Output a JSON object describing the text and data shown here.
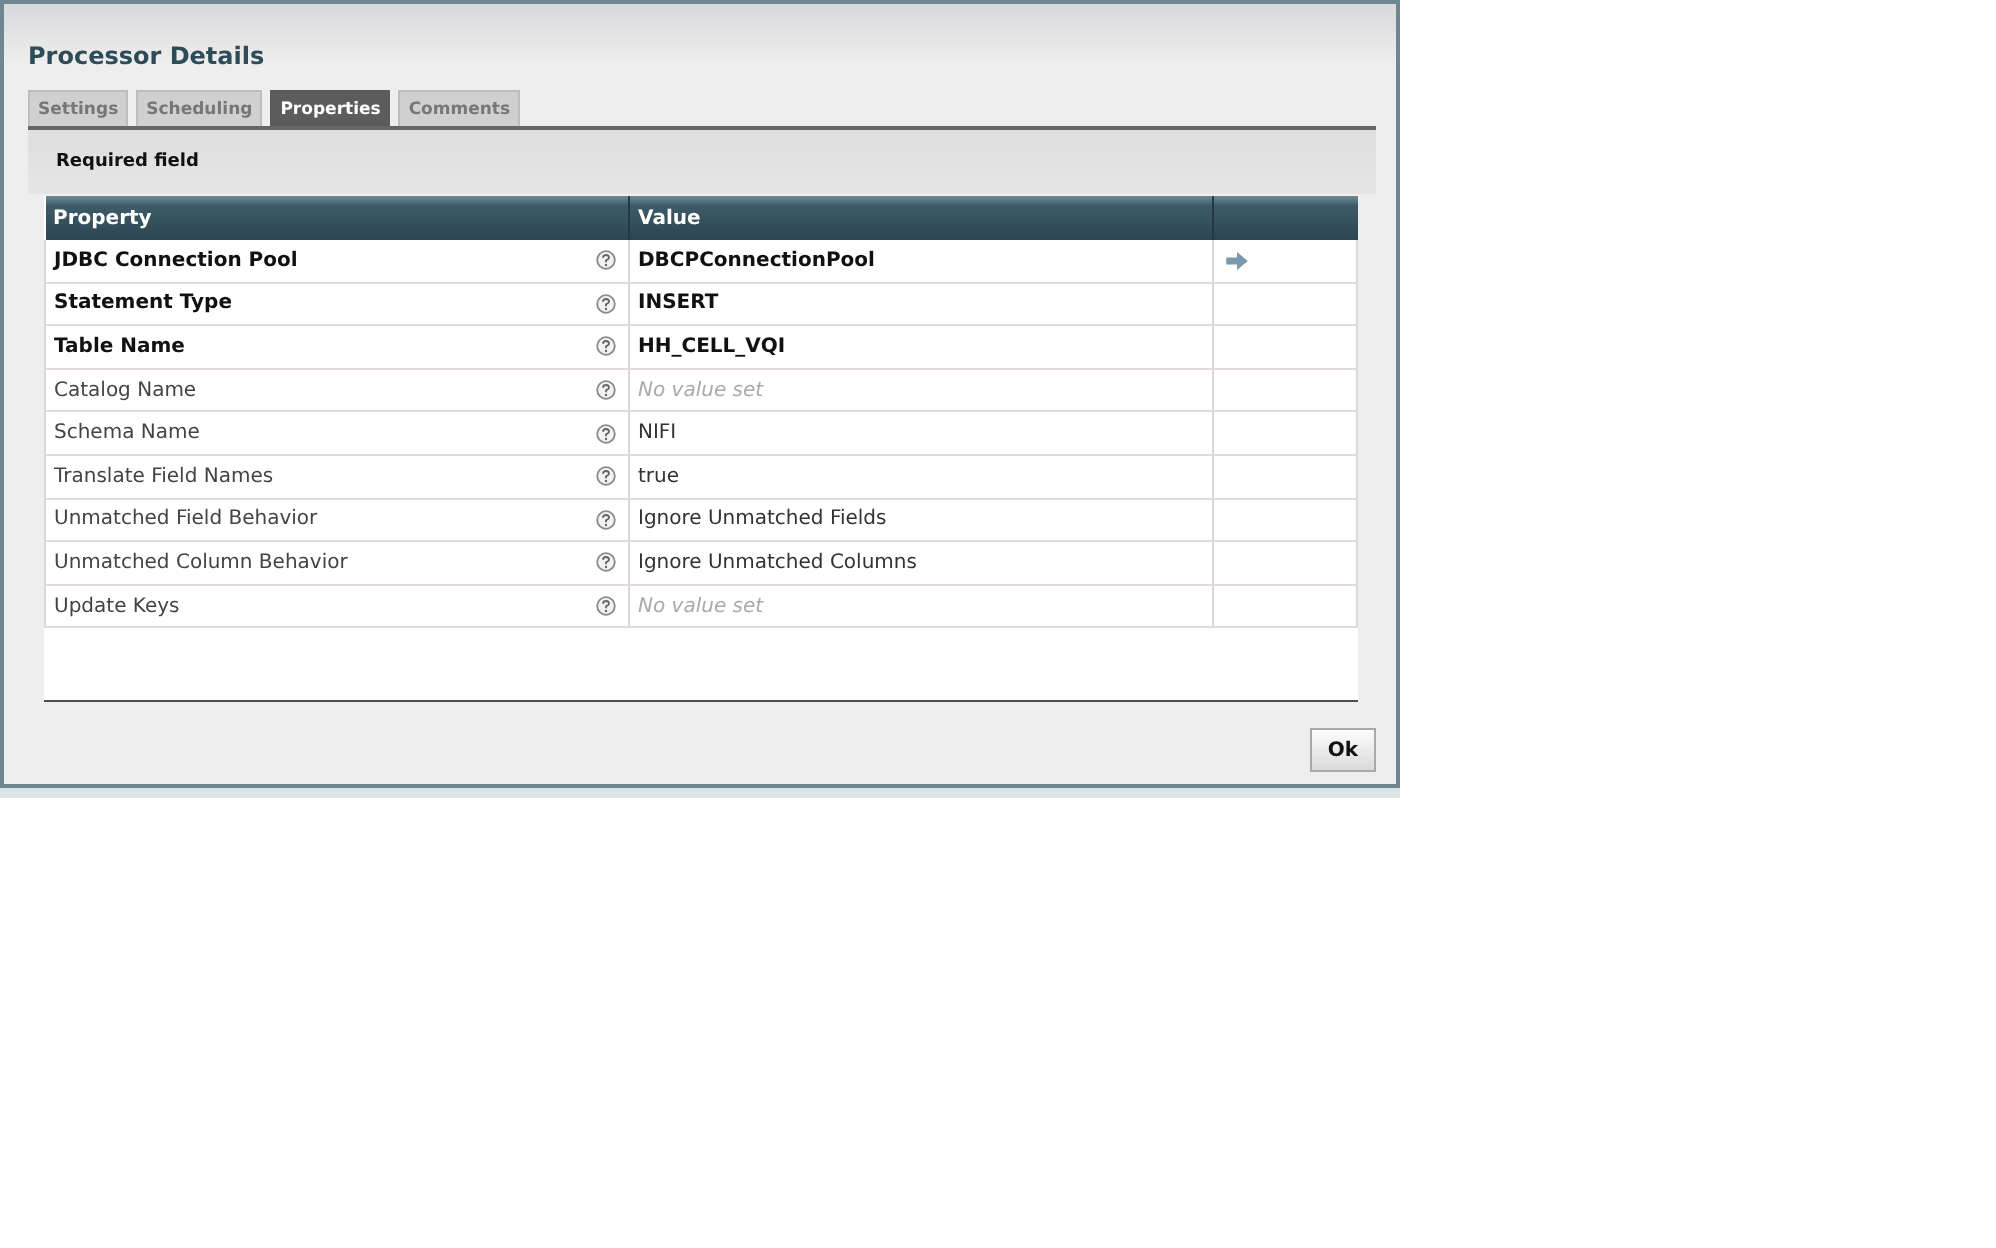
{
  "dialog": {
    "title": "Processor Details"
  },
  "tabs": [
    {
      "label": "Settings",
      "selected": false
    },
    {
      "label": "Scheduling",
      "selected": false
    },
    {
      "label": "Properties",
      "selected": true
    },
    {
      "label": "Comments",
      "selected": false
    }
  ],
  "notice": "Required field",
  "table": {
    "columns": [
      "Property",
      "Value"
    ],
    "rows": [
      {
        "property": "JDBC Connection Pool",
        "required": true,
        "value": "DBCPConnectionPool",
        "value_set": true,
        "has_link": true
      },
      {
        "property": "Statement Type",
        "required": true,
        "value": "INSERT",
        "value_set": true,
        "has_link": false
      },
      {
        "property": "Table Name",
        "required": true,
        "value": "HH_CELL_VQI",
        "value_set": true,
        "has_link": false
      },
      {
        "property": "Catalog Name",
        "required": false,
        "value": "No value set",
        "value_set": false,
        "has_link": false
      },
      {
        "property": "Schema Name",
        "required": false,
        "value": "NIFI",
        "value_set": true,
        "has_link": false
      },
      {
        "property": "Translate Field Names",
        "required": false,
        "value": "true",
        "value_set": true,
        "has_link": false
      },
      {
        "property": "Unmatched Field Behavior",
        "required": false,
        "value": "Ignore Unmatched Fields",
        "value_set": true,
        "has_link": false
      },
      {
        "property": "Unmatched Column Behavior",
        "required": false,
        "value": "Ignore Unmatched Columns",
        "value_set": true,
        "has_link": false
      },
      {
        "property": "Update Keys",
        "required": false,
        "value": "No value set",
        "value_set": false,
        "has_link": false
      }
    ]
  },
  "buttons": [
    {
      "label": "Ok"
    }
  ]
}
